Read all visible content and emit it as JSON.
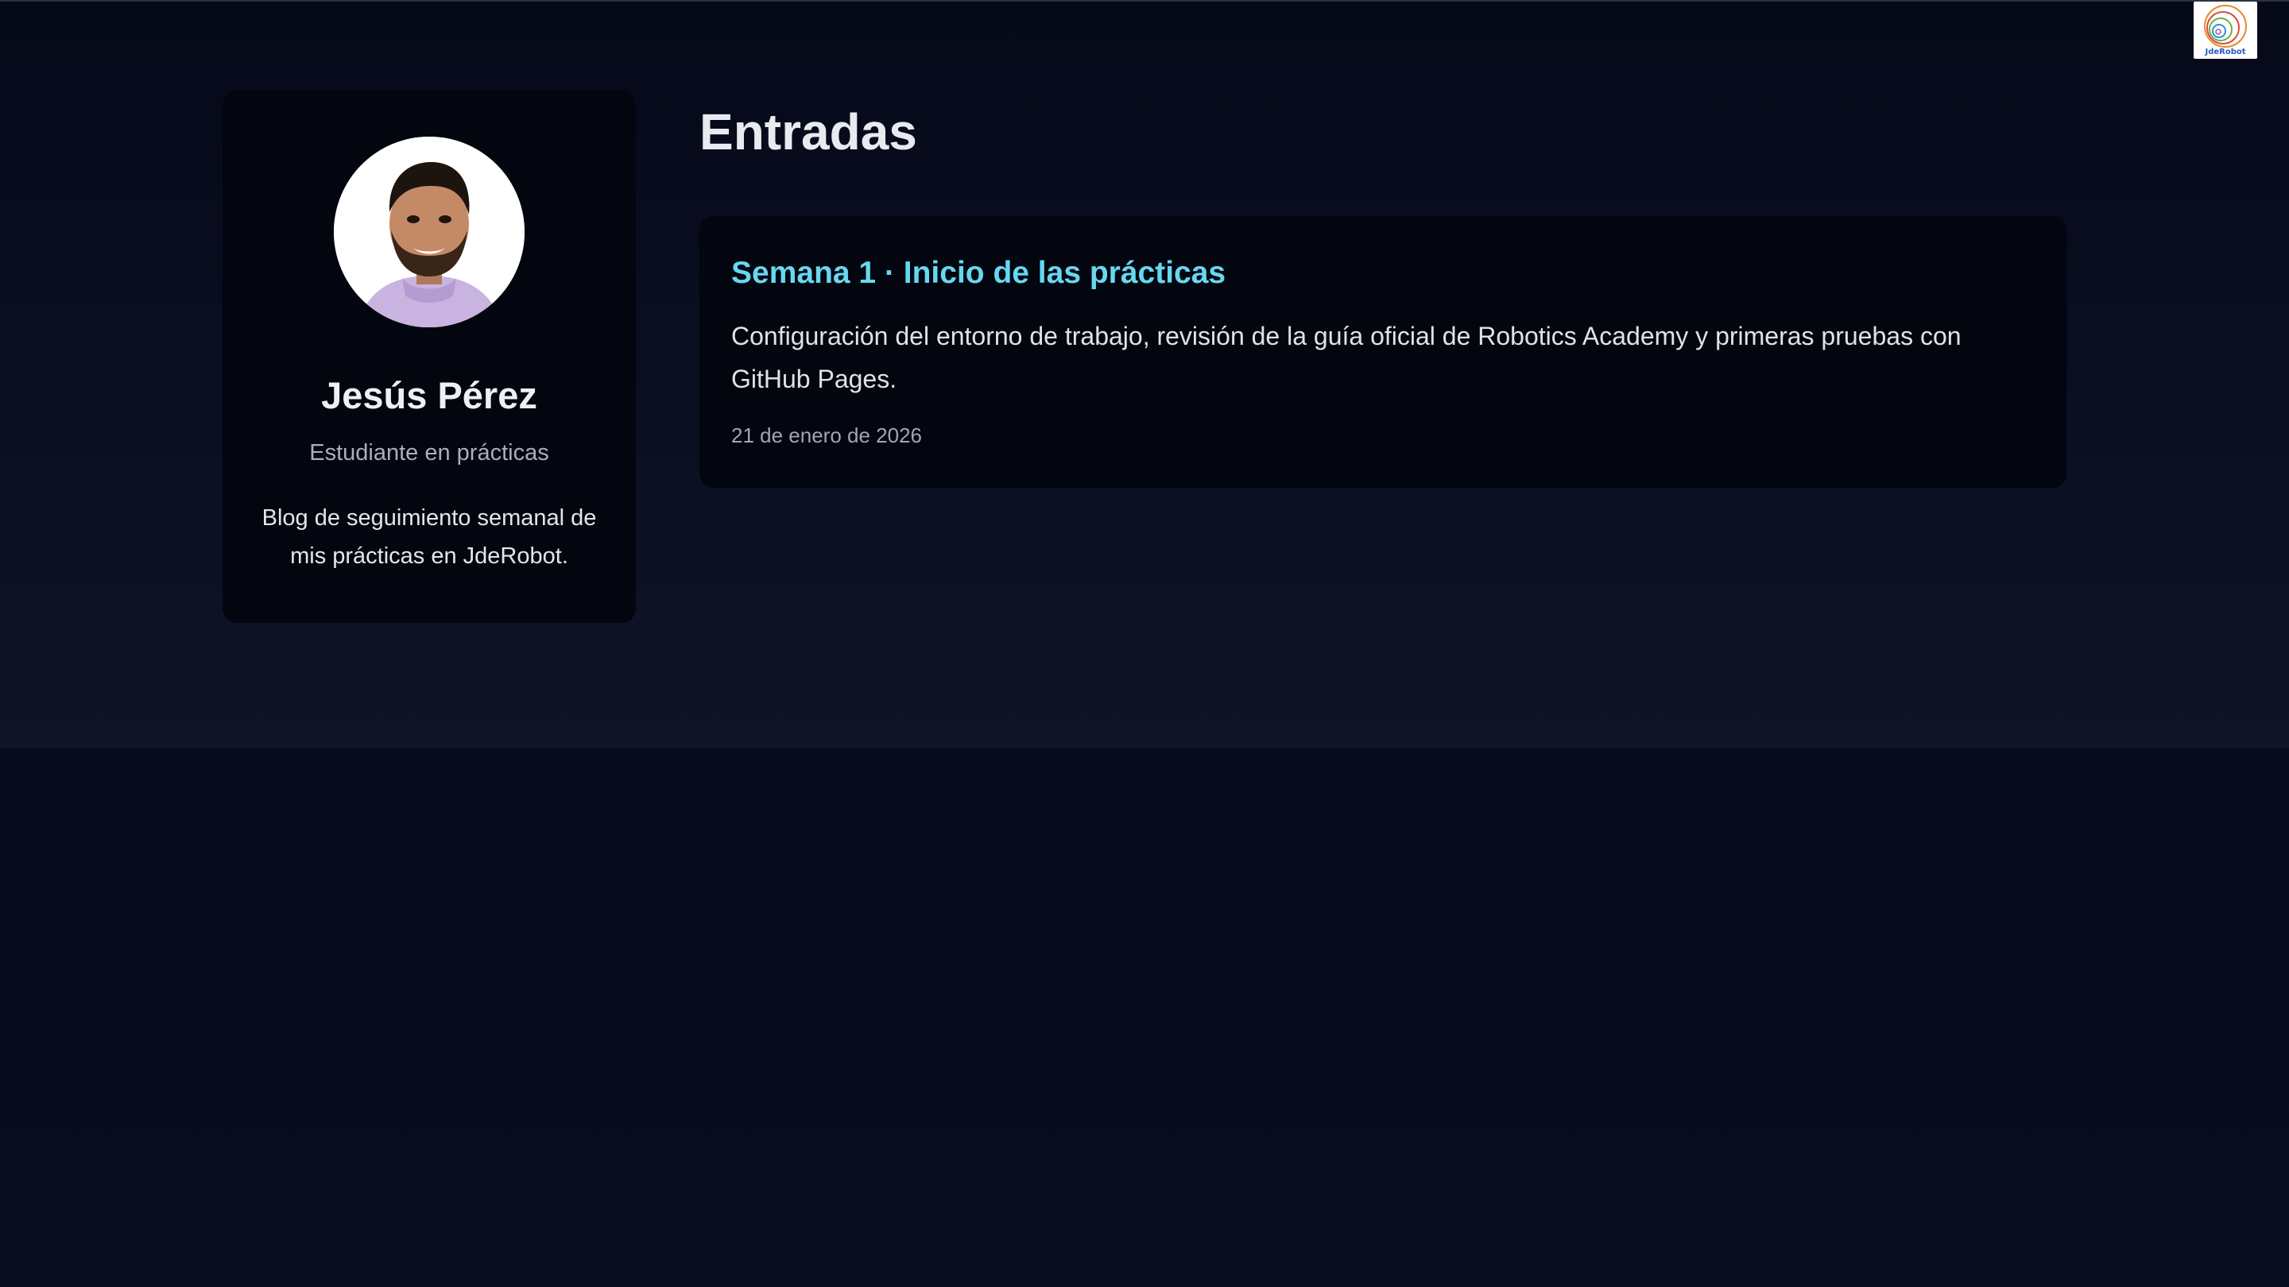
{
  "logo": {
    "text": "JdeRobot",
    "icon": "concentric-rings-logo"
  },
  "profile": {
    "avatar_icon": "profile-photo",
    "name": "Jesús Pérez",
    "role": "Estudiante en prácticas",
    "description": "Blog de seguimiento semanal de mis prácticas en JdeRobot."
  },
  "main": {
    "section_title": "Entradas",
    "posts": [
      {
        "title": "Semana 1 · Inicio de las prácticas",
        "excerpt": "Configuración del entorno de trabajo, revisión de la guía oficial de Robotics Academy y primeras pruebas con GitHub Pages.",
        "date": "21 de enero de 2026"
      }
    ]
  },
  "colors": {
    "background": "#060a1b",
    "card": "#03050f",
    "accent": "#66d8f0",
    "text": "#e8eaef",
    "muted": "#a9afbc"
  }
}
